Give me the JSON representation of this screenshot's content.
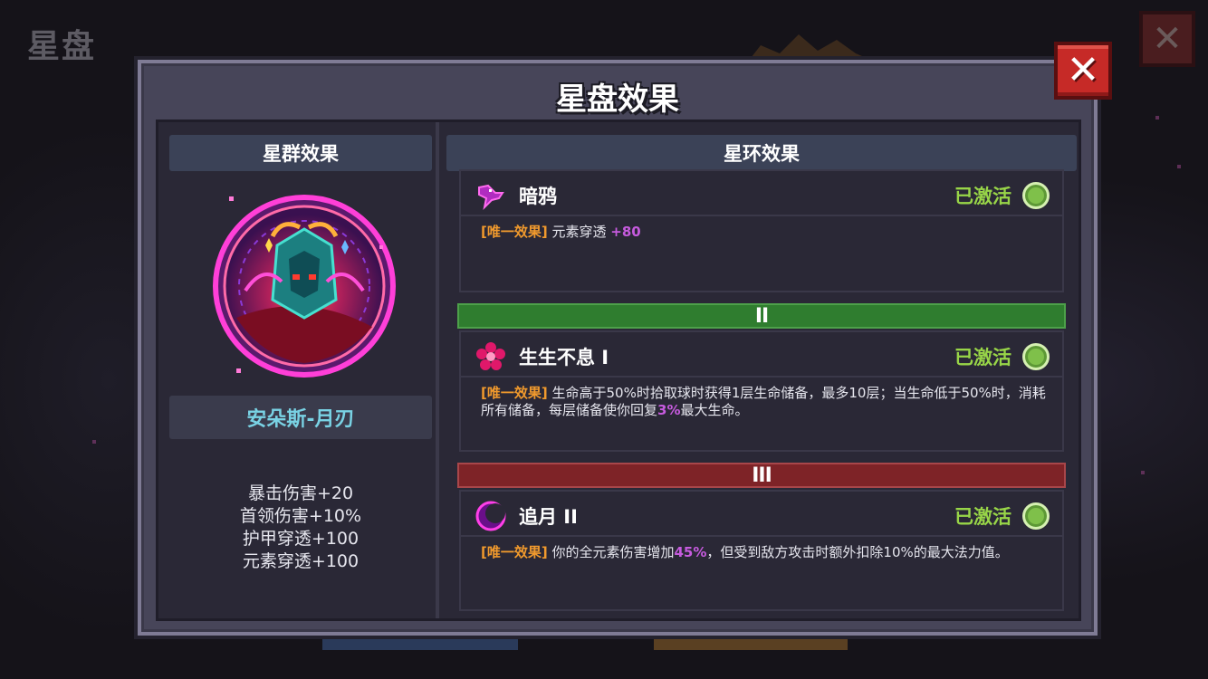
{
  "background": {
    "page_title": "星盘",
    "close_label": "✕"
  },
  "dialog": {
    "title": "星盘效果",
    "close_label": "✕"
  },
  "left": {
    "header": "星群效果",
    "constellation_name": "安朵斯-月刃",
    "emblem_icon": "constellation-emblem-icon",
    "stats": [
      "暴击伤害+20",
      "首领伤害+10%",
      "护甲穿透+100",
      "元素穿透+100"
    ]
  },
  "right": {
    "header": "星环效果",
    "cards": [
      {
        "icon": "raven-icon",
        "name": "暗鸦",
        "status": "已激活",
        "tag": "[唯一效果]",
        "desc_parts": [
          " 元素穿透 ",
          "+80"
        ]
      },
      {
        "tier": "II",
        "icon": "flower-icon",
        "name": "生生不息 I",
        "status": "已激活",
        "tag": "[唯一效果]",
        "desc_parts": [
          " 生命高于50%时拾取球时获得1层生命储备，最多10层；当生命低于50%时，消耗所有储备，每层储备使你回复",
          "3%",
          "最大生命。"
        ]
      },
      {
        "tier": "III",
        "icon": "crescent-moon-icon",
        "name": "追月 II",
        "status": "已激活",
        "tag": "[唯一效果]",
        "desc_parts": [
          " 你的全元素伤害增加",
          "45%",
          "，但受到敌方攻击时额外扣除10%的最大法力值。"
        ]
      }
    ]
  },
  "colors": {
    "status_green": "#98d548",
    "tag_orange": "#f19a2d",
    "highlight_purple": "#c65bde",
    "name_cyan": "#79d2e4",
    "tier2_green": "#2f7d2f",
    "tier3_red": "#7e2327",
    "close_red": "#c62a27"
  }
}
